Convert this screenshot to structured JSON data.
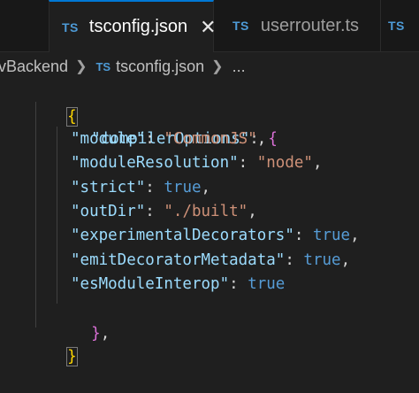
{
  "tabs": [
    {
      "icon": "TS",
      "label": "tsconfig.json",
      "close": "✕"
    },
    {
      "icon": "TS",
      "label": "userrouter.ts"
    },
    {
      "icon": "TS"
    }
  ],
  "breadcrumb": {
    "folder": "vBackend",
    "icon": "TS",
    "file": "tsconfig.json",
    "more": "..."
  },
  "code": {
    "open_brace": "{",
    "compiler_key": "\"compilerOptions\"",
    "compiler_open": "{",
    "options": [
      {
        "key": "\"module\"",
        "value": "\"CommonJS\"",
        "type": "string",
        "comma": ","
      },
      {
        "key": "\"moduleResolution\"",
        "value": "\"node\"",
        "type": "string",
        "comma": ","
      },
      {
        "key": "\"strict\"",
        "value": "true",
        "type": "bool",
        "comma": ","
      },
      {
        "key": "\"outDir\"",
        "value": "\"./built\"",
        "type": "string",
        "comma": ","
      },
      {
        "key": "\"experimentalDecorators\"",
        "value": "true",
        "type": "bool",
        "comma": ","
      },
      {
        "key": "\"emitDecoratorMetadata\"",
        "value": "true",
        "type": "bool",
        "comma": ","
      },
      {
        "key": "\"esModuleInterop\"",
        "value": "true",
        "type": "bool",
        "comma": ""
      }
    ],
    "compiler_close": "}",
    "compiler_close_comma": ",",
    "close_brace": "}"
  },
  "colors": {
    "key": "#9cdcfe",
    "string": "#ce9178",
    "boolean": "#569cd6",
    "bracket_level1": "#ffd700",
    "bracket_level2": "#da70d6",
    "tab_accent": "#0078d4",
    "ts_icon": "#4d9ad6"
  }
}
